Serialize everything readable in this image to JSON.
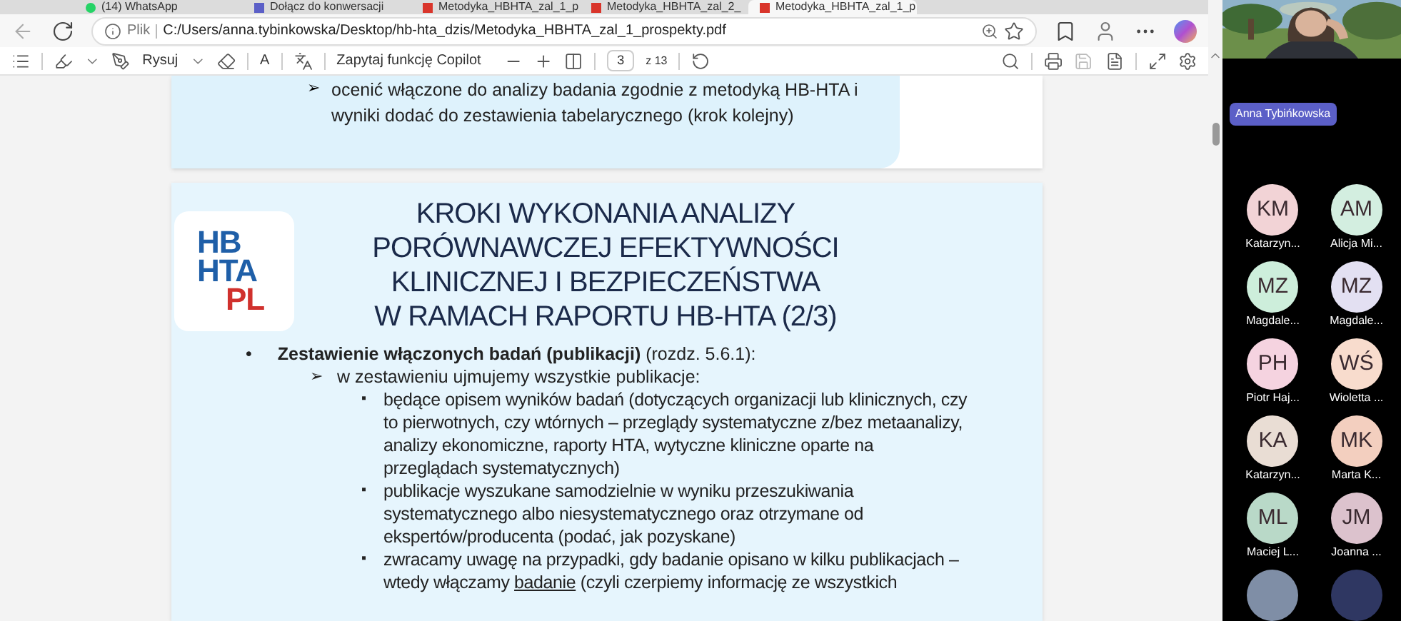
{
  "tabs": [
    {
      "title": "(14) WhatsApp",
      "selected": false
    },
    {
      "title": "Dołącz do konwersacji",
      "selected": false
    },
    {
      "title": "Metodyka_HBHTA_zal_1_p",
      "selected": false
    },
    {
      "title": "Metodyka_HBHTA_zal_2_",
      "selected": false
    },
    {
      "title": "Metodyka_HBHTA_zal_1_p",
      "selected": true
    }
  ],
  "address_bar": {
    "scheme_label": "Plik",
    "url": "C:/Users/anna.tybinkowska/Desktop/hb-hta_dzis/Metodyka_HBHTA_zal_1_prospekty.pdf"
  },
  "pdf_toolbar": {
    "draw_label": "Rysuj",
    "read_aloud_label": "A",
    "copilot_label": "Zapytaj funkcję Copilot",
    "page_number": "3",
    "page_count": "z 13"
  },
  "page_1": {
    "arrow": "➢",
    "text": "ocenić włączone do analizy badania zgodnie z metodyką HB-HTA i wyniki dodać do zestawienia tabelarycznego (krok kolejny)"
  },
  "page_2": {
    "logo": [
      "HB",
      "HTA",
      "PL"
    ],
    "title": [
      "KROKI WYKONANIA ANALIZY",
      "PORÓWNAWCZEJ EFEKTYWNOŚCI",
      "KLINICZNEJ I BEZPIECZEŃSTWA",
      "W RAMACH RAPORTU HB-HTA (2/3)"
    ],
    "bullet": "•",
    "heading": "**Zestawienie włączonych badań (publikacji)** (rozdz. 5.6.1):",
    "sub_arrow": "➢",
    "sub_heading": "w zestawieniu ujmujemy wszystkie publikacje:",
    "items": [
      {
        "mark": "▪",
        "text": "będące opisem wyników badań (dotyczących organizacji lub klinicznych, czy to pierwotnych, czy wtórnych – przeglądy systematyczne z/bez metaanalizy, analizy ekonomiczne, raporty HTA, wytyczne kliniczne oparte na przeglądach systematycznych)"
      },
      {
        "mark": "▪",
        "text": "publikacje wyszukane samodzielnie w wyniku przeszukiwania systematycznego albo niesystematycznego oraz otrzymane od ekspertów/producenta (podać, jak pozyskane)"
      },
      {
        "mark": "▪",
        "text": "zwracamy uwagę na przypadki, gdy badanie opisano w kilku publikacjach – wtedy włączamy ",
        "underlined": "badanie",
        "after": " (czyli czerpiemy informację ze wszystkich"
      }
    ]
  },
  "call": {
    "presenter": "Anna Tybińkowska",
    "participants": [
      {
        "initials": "KM",
        "name": "Katarzyn...",
        "color": "#f2d3d6"
      },
      {
        "initials": "AM",
        "name": "Alicja Mi...",
        "color": "#d3eee0"
      },
      {
        "initials": "MZ",
        "name": "Magdale...",
        "color": "#cdeedb"
      },
      {
        "initials": "MZ",
        "name": "Magdale...",
        "color": "#e3e0f2"
      },
      {
        "initials": "PH",
        "name": "Piotr Haj...",
        "color": "#f5d3e0"
      },
      {
        "initials": "WŚ",
        "name": "Wioletta ...",
        "color": "#f8dccd"
      },
      {
        "initials": "KA",
        "name": "Katarzyn...",
        "color": "#e9ddd4"
      },
      {
        "initials": "MK",
        "name": "Marta K...",
        "color": "#f3cfbf"
      },
      {
        "initials": "ML",
        "name": "Maciej L...",
        "color": "#b9d9c8"
      },
      {
        "initials": "JM",
        "name": "Joanna ...",
        "color": "#dcc2cd"
      },
      {
        "color": "#7f8ea6"
      },
      {
        "color": "#2f3762"
      }
    ]
  }
}
